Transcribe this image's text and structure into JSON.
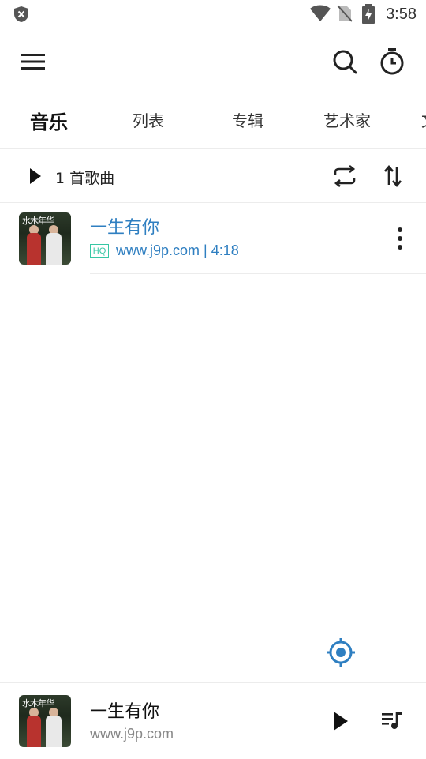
{
  "status_bar": {
    "time": "3:58"
  },
  "tabs": [
    {
      "label": "音乐"
    },
    {
      "label": "列表"
    },
    {
      "label": "专辑"
    },
    {
      "label": "艺术家"
    },
    {
      "label": "文"
    }
  ],
  "toolbar": {
    "menu_icon": "menu-icon",
    "search_icon": "search-icon",
    "timer_icon": "timer-icon"
  },
  "play_all": {
    "count_text": "1 首歌曲"
  },
  "songs": [
    {
      "cover_text": "水木年华",
      "title": "一生有你",
      "quality_badge": "HQ",
      "artist_duration": "www.j9p.com | 4:18"
    }
  ],
  "now_playing": {
    "cover_text": "水木年华",
    "title": "一生有你",
    "artist": "www.j9p.com"
  },
  "colors": {
    "accent": "#2f7fc1",
    "badge": "#37c7a4"
  }
}
